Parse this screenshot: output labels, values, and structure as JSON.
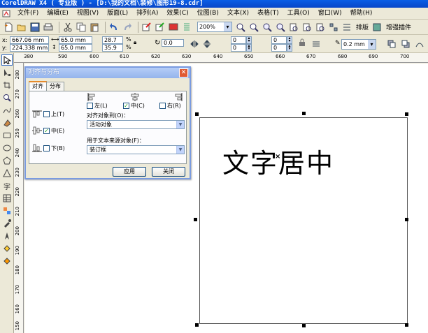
{
  "app": {
    "title": "CorelDRAW X4 ( 专业版 ) - [D:\\我的文档\\装修\\图形19-8.cdr]"
  },
  "menu": {
    "items": [
      "文件(F)",
      "编辑(E)",
      "视图(V)",
      "版面(L)",
      "排列(A)",
      "效果(C)",
      "位图(B)",
      "文本(X)",
      "表格(T)",
      "工具(O)",
      "窗口(W)",
      "帮助(H)"
    ]
  },
  "toolbar": {
    "zoom": "200%",
    "arrange_label": "排版",
    "plugin_label": "增强插件"
  },
  "propertybar": {
    "x_label": "x:",
    "x_value": "667.06 mm",
    "y_label": "y:",
    "y_value": "224.338 mm",
    "width_value": "65.0 mm",
    "height_value": "65.0 mm",
    "scale_x": "28.7",
    "scale_y": "35.9",
    "percent": "%",
    "rotation": "0.0",
    "offset_1": "0",
    "offset_2": "0",
    "offset_3": "0",
    "offset_4": "0",
    "outline_width": "0.2 mm"
  },
  "hruler": {
    "labels": [
      "380",
      "590",
      "600",
      "610",
      "620",
      "630",
      "640",
      "650",
      "660",
      "670",
      "680",
      "690",
      "700"
    ]
  },
  "vruler": {
    "labels": [
      "280",
      "270",
      "260",
      "250",
      "240",
      "230",
      "220",
      "210",
      "200",
      "190",
      "180",
      "170",
      "160",
      "150"
    ]
  },
  "toolbox": {
    "tools": [
      "pick-tool-icon",
      "shape-tool-icon",
      "crop-tool-icon",
      "zoom-tool-icon",
      "freehand-tool-icon",
      "smart-fill-icon",
      "rectangle-tool-icon",
      "ellipse-tool-icon",
      "polygon-tool-icon",
      "basic-shapes-icon",
      "text-tool-icon",
      "table-tool-icon",
      "blend-tool-icon",
      "eyedropper-tool-icon",
      "outline-tool-icon",
      "fill-tool-icon",
      "interactive-fill-icon"
    ],
    "text_tool_glyph": "字"
  },
  "canvas": {
    "text": "文字居中",
    "center_mark": "×"
  },
  "dialog": {
    "title": "对齐与分布",
    "close": "✕",
    "tabs": [
      "对齐",
      "分布"
    ],
    "left": "左(L)",
    "center_h": "中(C)",
    "right": "右(R)",
    "top": "上(T)",
    "center_v": "中(E)",
    "bottom": "下(B)",
    "align_to_label": "对齐对象到(O)：",
    "align_to_value": "活动对象",
    "text_source_label": "用于文本来源对象(F)：",
    "text_source_value": "装订框",
    "apply_button": "应用",
    "close_button": "关闭",
    "checked": {
      "left": false,
      "center_h": true,
      "right": false,
      "top": false,
      "center_v": true,
      "bottom": false
    }
  },
  "colors": {
    "title_bar": "#0a5ee6",
    "dialog_title": "#95b4ec",
    "check_mark": "#21a121"
  }
}
